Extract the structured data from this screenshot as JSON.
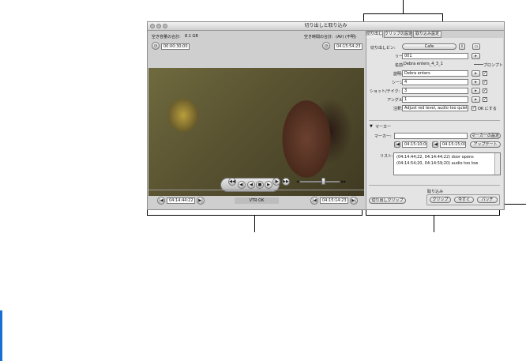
{
  "window": {
    "title": "切り出しと取り込み",
    "free_space_label": "空き容量の合計:",
    "free_space_value": "8.1 GB",
    "free_time_label": "空き時間の合計:",
    "free_time_value": "(AV) (不明)",
    "duration": "00:00:30;00",
    "current_timecode": "04:15:54:23",
    "in_timecode": "04:14:44:22",
    "out_timecode": "04:15:14:23",
    "vtr_status": "VTR OK"
  },
  "tabs": [
    "切り出し",
    "クリップの設定",
    "取り込み設定"
  ],
  "log": {
    "bin_label": "切り出しビン:",
    "bin_value": "Cafe",
    "reel_label": "リール:",
    "reel_value": "001",
    "name_label": "名前:",
    "name_value": "Debra enters_4_3_1",
    "prompt_label": "プロンプト",
    "description_label": "説明:",
    "description_value": "Debra enters",
    "scene_label": "シーン:",
    "scene_value": "4",
    "shot_label": "ショット/テイク:",
    "shot_value": "3",
    "angle_label": "アングル:",
    "angle_value": "1",
    "note_label": "注釈:",
    "note_value": "Adjust red level, audio too quiet",
    "ok_label": "OK にする"
  },
  "markers": {
    "header": "マーカー",
    "marker_label": "マーカー:",
    "set_marker": "マーカーの設定",
    "in": "04:15:10;00",
    "out": "04:15:15;00",
    "update": "アップデート",
    "list_label": "リスト:",
    "list": [
      "(04:14:44;22, 04:14:44;22) door opens",
      "(04:14:54;20, 04:14:59;20) audio too low"
    ]
  },
  "capture": {
    "log_clip": "切り出しクリップ",
    "group_label": "取り込み",
    "clip": "クリップ",
    "now": "今すぐ",
    "batch": "バッチ"
  },
  "transport": {
    "prev": "◀◀",
    "play_in": "◀|",
    "rewind": "◀",
    "stop": "■",
    "play": "▶",
    "play_out": "|▶",
    "next": "▶▶",
    "shuttle_left": "◀",
    "shuttle_right": "▶▶"
  },
  "colors": {
    "window_bg": "#cfcfcf",
    "callout_line": "#000000",
    "left_bar": "#1a6fd0"
  }
}
